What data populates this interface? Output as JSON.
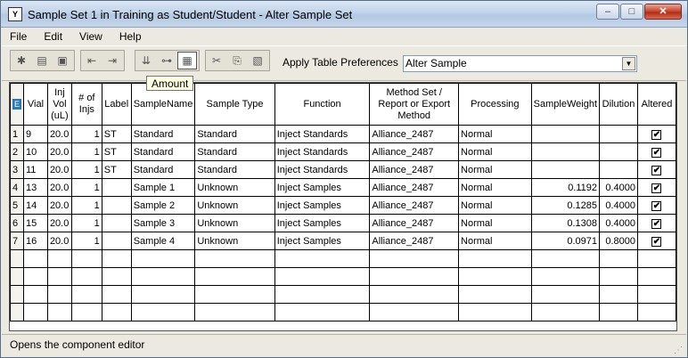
{
  "window": {
    "title": "Sample Set 1 in Training as Student/Student - Alter Sample Set",
    "icon": "Y",
    "minimize": "–",
    "maximize": "□",
    "close": "✕"
  },
  "menu": [
    "File",
    "Edit",
    "View",
    "Help"
  ],
  "toolbar": {
    "tooltip": "Amount",
    "preferences_label": "Apply Table Preferences",
    "preferences_value": "Alter Sample",
    "dropdown_arrow": "▼",
    "icons": {
      "new_sample_set": "✱",
      "open": "▤",
      "save": "▣",
      "insert_row_left": "⇤",
      "insert_row_right": "⇥",
      "fill_down": "⇊",
      "amount": "⊶",
      "component_editor": "▦",
      "cut": "✂",
      "copy": "⎘",
      "paste": "▧"
    }
  },
  "table": {
    "corner_icon": "E",
    "headers": [
      "Vial",
      "Inj Vol (uL)",
      "# of Injs",
      "Label",
      "SampleName",
      "Sample Type",
      "Function",
      "Method Set / Report or Export Method",
      "Processing",
      "SampleWeight",
      "Dilution",
      "Altered"
    ],
    "rows": [
      {
        "n": "1",
        "vial": "9",
        "injvol": "20.0",
        "injs": "1",
        "label": "ST",
        "name": "Standard",
        "type": "Standard",
        "function": "Inject Standards",
        "method": "Alliance_2487",
        "processing": "Normal",
        "weight": "",
        "dilution": "",
        "altered": "✔"
      },
      {
        "n": "2",
        "vial": "10",
        "injvol": "20.0",
        "injs": "1",
        "label": "ST",
        "name": "Standard",
        "type": "Standard",
        "function": "Inject Standards",
        "method": "Alliance_2487",
        "processing": "Normal",
        "weight": "",
        "dilution": "",
        "altered": "✔"
      },
      {
        "n": "3",
        "vial": "11",
        "injvol": "20.0",
        "injs": "1",
        "label": "ST",
        "name": "Standard",
        "type": "Standard",
        "function": "Inject Standards",
        "method": "Alliance_2487",
        "processing": "Normal",
        "weight": "",
        "dilution": "",
        "altered": "✔"
      },
      {
        "n": "4",
        "vial": "13",
        "injvol": "20.0",
        "injs": "1",
        "label": "",
        "name": "Sample 1",
        "type": "Unknown",
        "function": "Inject Samples",
        "method": "Alliance_2487",
        "processing": "Normal",
        "weight": "0.1192",
        "dilution": "0.4000",
        "altered": "✔"
      },
      {
        "n": "5",
        "vial": "14",
        "injvol": "20.0",
        "injs": "1",
        "label": "",
        "name": "Sample 2",
        "type": "Unknown",
        "function": "Inject Samples",
        "method": "Alliance_2487",
        "processing": "Normal",
        "weight": "0.1285",
        "dilution": "0.4000",
        "altered": "✔"
      },
      {
        "n": "6",
        "vial": "15",
        "injvol": "20.0",
        "injs": "1",
        "label": "",
        "name": "Sample 3",
        "type": "Unknown",
        "function": "Inject Samples",
        "method": "Alliance_2487",
        "processing": "Normal",
        "weight": "0.1308",
        "dilution": "0.4000",
        "altered": "✔"
      },
      {
        "n": "7",
        "vial": "16",
        "injvol": "20.0",
        "injs": "1",
        "label": "",
        "name": "Sample 4",
        "type": "Unknown",
        "function": "Inject Samples",
        "method": "Alliance_2487",
        "processing": "Normal",
        "weight": "0.0971",
        "dilution": "0.8000",
        "altered": "✔"
      }
    ]
  },
  "status": {
    "text": "Opens the component editor",
    "grip": "⋰"
  }
}
